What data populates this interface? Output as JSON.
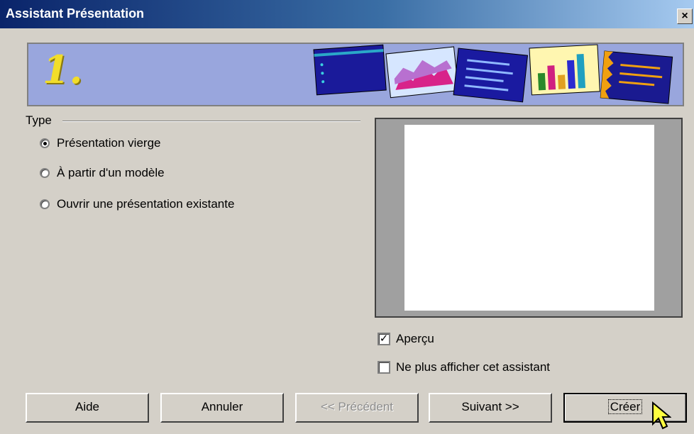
{
  "window": {
    "title": "Assistant Présentation",
    "close_label": "×"
  },
  "banner": {
    "step": "1."
  },
  "type_group": {
    "label": "Type",
    "options": [
      {
        "label": "Présentation vierge",
        "checked": true
      },
      {
        "label": "À partir d'un modèle",
        "checked": false
      },
      {
        "label": "Ouvrir une présentation existante",
        "checked": false
      }
    ]
  },
  "preview": {
    "preview_label": "Aperçu",
    "preview_checked": true,
    "no_show_label": "Ne plus afficher cet assistant",
    "no_show_checked": false
  },
  "buttons": {
    "help": "Aide",
    "cancel": "Annuler",
    "previous": "<< Précédent",
    "next": "Suivant >>",
    "create": "Créer"
  }
}
